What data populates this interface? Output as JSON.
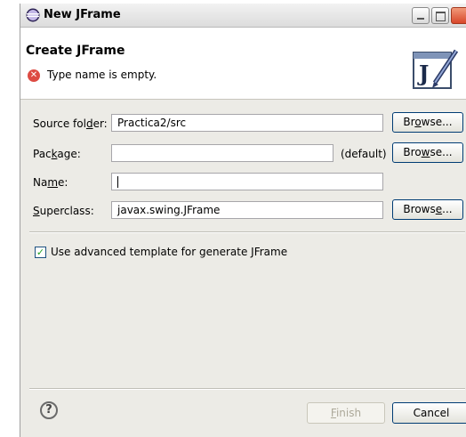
{
  "window": {
    "title": "New JFrame"
  },
  "banner": {
    "title": "Create JFrame",
    "error_message": "Type name is empty."
  },
  "form": {
    "source_folder": {
      "label_pre": "Source fol",
      "label_mnemonic": "d",
      "label_post": "er:",
      "value": "Practica2/src",
      "browse_pre": "Br",
      "browse_mnemonic": "o",
      "browse_post": "wse..."
    },
    "package": {
      "label_pre": "Pac",
      "label_mnemonic": "k",
      "label_post": "age:",
      "value": "",
      "default_label": "(default)",
      "browse_pre": "Bro",
      "browse_mnemonic": "w",
      "browse_post": "se..."
    },
    "name": {
      "label_pre": "Na",
      "label_mnemonic": "m",
      "label_post": "e:",
      "value": ""
    },
    "superclass": {
      "label_pre": "",
      "label_mnemonic": "S",
      "label_post": "uperclass:",
      "value": "javax.swing.JFrame",
      "browse_pre": "Brows",
      "browse_mnemonic": "e",
      "browse_post": "..."
    }
  },
  "options": {
    "advanced_template_label": "Use advanced template for generate JFrame",
    "advanced_template_checked": true
  },
  "footer": {
    "finish_pre": "",
    "finish_mnemonic": "F",
    "finish_post": "inish",
    "cancel_label": "Cancel"
  },
  "icons": {
    "title": "eclipse-icon",
    "error": "error-icon",
    "banner": "jframe-wizard-icon",
    "help": "help-icon"
  }
}
